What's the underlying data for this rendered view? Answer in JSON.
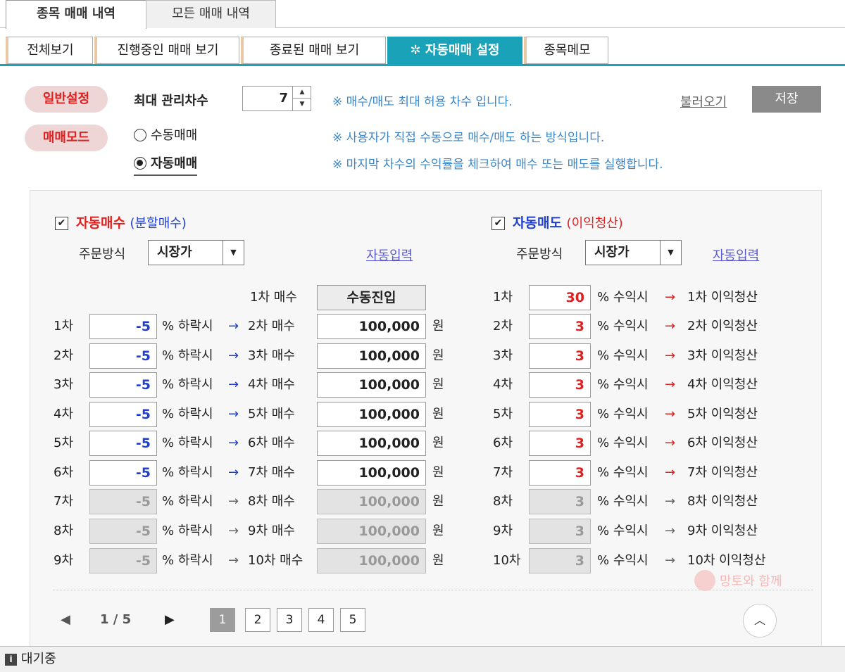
{
  "top_tabs": [
    {
      "label": "종목 매매 내역",
      "active": true
    },
    {
      "label": "모든 매매 내역",
      "active": false
    }
  ],
  "sub_tabs": [
    {
      "label": "전체보기"
    },
    {
      "label": "진행중인 매매 보기"
    },
    {
      "label": "종료된 매매 보기"
    },
    {
      "label": "자동매매 설정",
      "active": true,
      "icon": "gear-icon"
    },
    {
      "label": "종목메모"
    }
  ],
  "general": {
    "pill": "일반설정",
    "max_label": "최대 관리차수",
    "max_value": "7",
    "note": "※ 매수/매도 최대 허용 차수 입니다.",
    "load_label": "불러오기",
    "save_label": "저장"
  },
  "mode": {
    "pill": "매매모드",
    "manual_label": "수동매매",
    "auto_label": "자동매매",
    "selected": "auto",
    "note_manual": "※ 사용자가 직접 수동으로 매수/매도 하는 방식입니다.",
    "note_auto": "※ 마지막 차수의 수익률을 체크하여 매수 또는 매도를 실행합니다."
  },
  "buy": {
    "title": "자동매수",
    "subtitle": "(분할매수)",
    "checked": true,
    "order_label": "주문방식",
    "order_value": "시장가",
    "auto_input": "자동입력",
    "first_label": "1차 매수",
    "first_value": "수동진입",
    "pct_unit": "% 하락시",
    "won": "원",
    "rows": [
      {
        "step": "1차",
        "pct": "-5",
        "next": "2차 매수",
        "amount": "100,000",
        "enabled": true
      },
      {
        "step": "2차",
        "pct": "-5",
        "next": "3차 매수",
        "amount": "100,000",
        "enabled": true
      },
      {
        "step": "3차",
        "pct": "-5",
        "next": "4차 매수",
        "amount": "100,000",
        "enabled": true
      },
      {
        "step": "4차",
        "pct": "-5",
        "next": "5차 매수",
        "amount": "100,000",
        "enabled": true
      },
      {
        "step": "5차",
        "pct": "-5",
        "next": "6차 매수",
        "amount": "100,000",
        "enabled": true
      },
      {
        "step": "6차",
        "pct": "-5",
        "next": "7차 매수",
        "amount": "100,000",
        "enabled": true
      },
      {
        "step": "7차",
        "pct": "-5",
        "next": "8차 매수",
        "amount": "100,000",
        "enabled": false
      },
      {
        "step": "8차",
        "pct": "-5",
        "next": "9차 매수",
        "amount": "100,000",
        "enabled": false
      },
      {
        "step": "9차",
        "pct": "-5",
        "next": "10차 매수",
        "amount": "100,000",
        "enabled": false
      }
    ]
  },
  "sell": {
    "title": "자동매도",
    "subtitle": "(이익청산)",
    "checked": true,
    "order_label": "주문방식",
    "order_value": "시장가",
    "auto_input": "자동입력",
    "pct_unit": "% 수익시",
    "rows": [
      {
        "step": "1차",
        "pct": "30",
        "next": "1차 이익청산",
        "enabled": true
      },
      {
        "step": "2차",
        "pct": "3",
        "next": "2차 이익청산",
        "enabled": true
      },
      {
        "step": "3차",
        "pct": "3",
        "next": "3차 이익청산",
        "enabled": true
      },
      {
        "step": "4차",
        "pct": "3",
        "next": "4차 이익청산",
        "enabled": true
      },
      {
        "step": "5차",
        "pct": "3",
        "next": "5차 이익청산",
        "enabled": true
      },
      {
        "step": "6차",
        "pct": "3",
        "next": "6차 이익청산",
        "enabled": true
      },
      {
        "step": "7차",
        "pct": "3",
        "next": "7차 이익청산",
        "enabled": true
      },
      {
        "step": "8차",
        "pct": "3",
        "next": "8차 이익청산",
        "enabled": false
      },
      {
        "step": "9차",
        "pct": "3",
        "next": "9차 이익청산",
        "enabled": false
      },
      {
        "step": "10차",
        "pct": "3",
        "next": "10차 이익청산",
        "enabled": false
      }
    ]
  },
  "pagination": {
    "current": "1 / 5",
    "pages": [
      "1",
      "2",
      "3",
      "4",
      "5"
    ],
    "active": "1"
  },
  "watermark": "망토와 함께",
  "status": {
    "text": "대기중"
  },
  "colors": {
    "accent": "#1aa3b8",
    "red": "#e0201e",
    "blue": "#1f3fd0",
    "note": "#3a86c8"
  }
}
